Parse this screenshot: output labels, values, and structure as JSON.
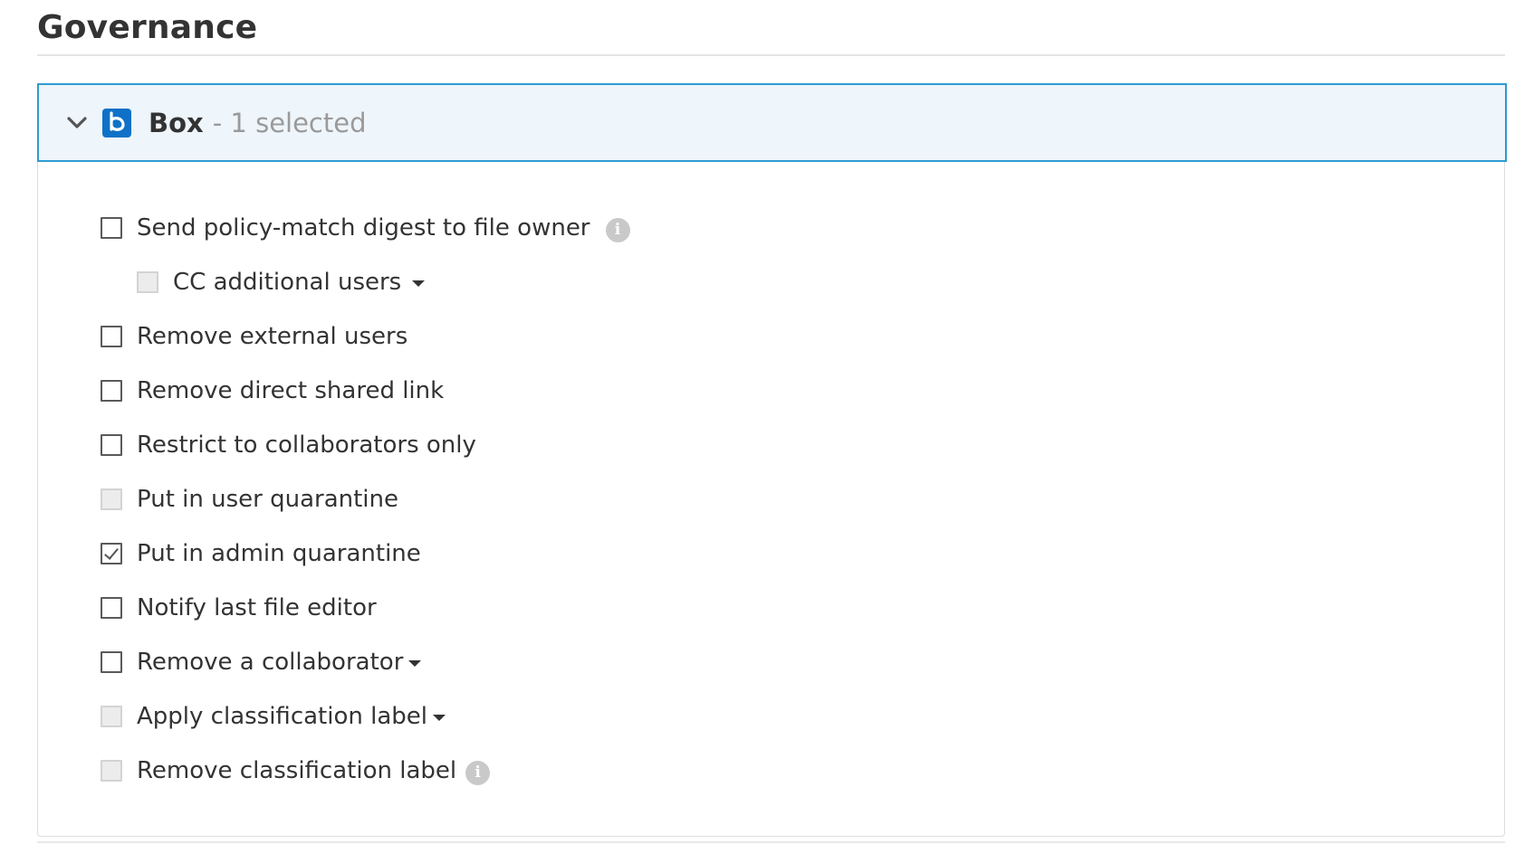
{
  "section": {
    "title": "Governance"
  },
  "panel": {
    "app_name": "Box",
    "selection_count": "- 1 selected",
    "icons": {
      "expand": "chevron-down-icon",
      "app": "box-logo-icon",
      "info": "info-icon",
      "dropdown": "caret-down-icon"
    },
    "options": [
      {
        "label": "Send policy-match digest to file owner",
        "checked": false,
        "disabled": false,
        "has_info": true,
        "has_dropdown": false
      },
      {
        "label": "CC additional users",
        "checked": false,
        "disabled": true,
        "has_info": false,
        "has_dropdown": true
      },
      {
        "label": "Remove external users",
        "checked": false,
        "disabled": false,
        "has_info": false,
        "has_dropdown": false
      },
      {
        "label": "Remove direct shared link",
        "checked": false,
        "disabled": false,
        "has_info": false,
        "has_dropdown": false
      },
      {
        "label": "Restrict to collaborators only",
        "checked": false,
        "disabled": false,
        "has_info": false,
        "has_dropdown": false
      },
      {
        "label": "Put in user quarantine",
        "checked": false,
        "disabled": true,
        "has_info": false,
        "has_dropdown": false
      },
      {
        "label": "Put in admin quarantine",
        "checked": true,
        "disabled": false,
        "has_info": false,
        "has_dropdown": false
      },
      {
        "label": "Notify last file editor",
        "checked": false,
        "disabled": false,
        "has_info": false,
        "has_dropdown": false
      },
      {
        "label": "Remove a collaborator",
        "checked": false,
        "disabled": false,
        "has_info": false,
        "has_dropdown": true
      },
      {
        "label": "Apply classification label",
        "checked": false,
        "disabled": true,
        "has_info": false,
        "has_dropdown": true
      },
      {
        "label": "Remove classification label",
        "checked": false,
        "disabled": true,
        "has_info": true,
        "has_dropdown": false
      }
    ]
  },
  "colors": {
    "accent_border": "#2f9bd1",
    "header_background": "#eef5fb",
    "app_icon": "#0e71c7"
  }
}
